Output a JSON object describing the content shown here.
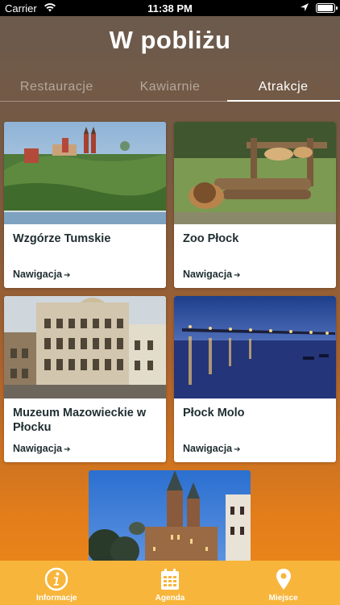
{
  "status": {
    "carrier": "Carrier",
    "time": "11:38 PM"
  },
  "header": {
    "title": "W pobliżu"
  },
  "tabs": [
    {
      "label": "Restauracje",
      "active": false
    },
    {
      "label": "Kawiarnie",
      "active": false
    },
    {
      "label": "Atrakcje",
      "active": true
    }
  ],
  "cards": [
    {
      "name": "Wzgórze Tumskie",
      "nav": "Nawigacja"
    },
    {
      "name": "Zoo Płock",
      "nav": "Nawigacja"
    },
    {
      "name": "Muzeum Mazowieckie w Płocku",
      "nav": "Nawigacja"
    },
    {
      "name": "Płock Molo",
      "nav": "Nawigacja"
    }
  ],
  "bottom_nav": [
    {
      "label": "Informacje",
      "icon": "info-icon"
    },
    {
      "label": "Agenda",
      "icon": "calendar-icon"
    },
    {
      "label": "Miejsce",
      "icon": "location-pin-icon"
    }
  ],
  "colors": {
    "accent": "#f7b53b",
    "text_dark": "#1f2d30"
  }
}
